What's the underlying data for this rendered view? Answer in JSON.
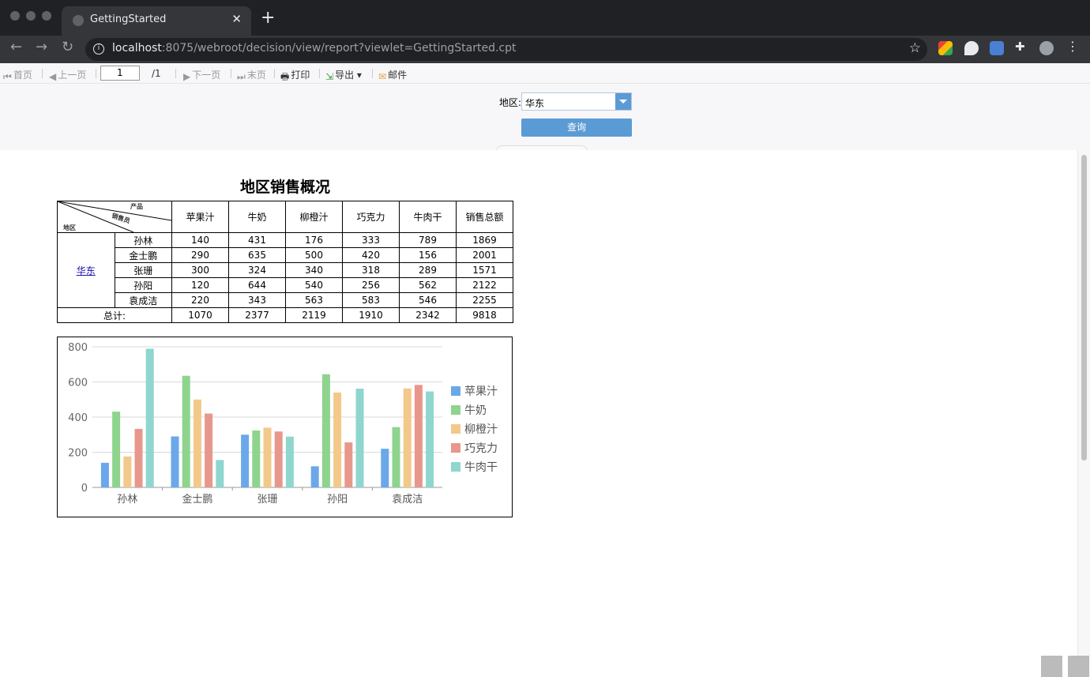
{
  "browser": {
    "tab_title": "GettingStarted",
    "url_host": "localhost",
    "url_rest": ":8075/webroot/decision/view/report?viewlet=GettingStarted.cpt"
  },
  "report_toolbar": {
    "first": "首页",
    "prev": "上一页",
    "page_value": "1",
    "page_total": "/1",
    "next": "下一页",
    "last": "末页",
    "print": "打印",
    "export": "导出",
    "mail": "邮件"
  },
  "params": {
    "region_label": "地区:",
    "region_value": "华东",
    "query_button": "查询"
  },
  "report": {
    "title": "地区销售概况",
    "header_diag": {
      "product": "产品",
      "salesperson": "销售员",
      "region": "地区"
    },
    "columns": [
      "苹果汁",
      "牛奶",
      "柳橙汁",
      "巧克力",
      "牛肉干",
      "销售总额"
    ],
    "region": "华东",
    "rows": [
      {
        "name": "孙林",
        "values": [
          "140",
          "431",
          "176",
          "333",
          "789",
          "1869"
        ]
      },
      {
        "name": "金士鹏",
        "values": [
          "290",
          "635",
          "500",
          "420",
          "156",
          "2001"
        ]
      },
      {
        "name": "张珊",
        "values": [
          "300",
          "324",
          "340",
          "318",
          "289",
          "1571"
        ]
      },
      {
        "name": "孙阳",
        "values": [
          "120",
          "644",
          "540",
          "256",
          "562",
          "2122"
        ]
      },
      {
        "name": "袁成洁",
        "values": [
          "220",
          "343",
          "563",
          "583",
          "546",
          "2255"
        ]
      }
    ],
    "total_label": "总计:",
    "totals": [
      "1070",
      "2377",
      "2119",
      "1910",
      "2342",
      "9818"
    ]
  },
  "chart_data": {
    "type": "bar",
    "categories": [
      "孙林",
      "金士鹏",
      "张珊",
      "孙阳",
      "袁成洁"
    ],
    "series": [
      {
        "name": "苹果汁",
        "color": "#6aa8ea",
        "values": [
          140,
          290,
          300,
          120,
          220
        ]
      },
      {
        "name": "牛奶",
        "color": "#8ed48e",
        "values": [
          431,
          635,
          324,
          644,
          343
        ]
      },
      {
        "name": "柳橙汁",
        "color": "#f2c98a",
        "values": [
          176,
          500,
          340,
          540,
          563
        ]
      },
      {
        "name": "巧克力",
        "color": "#e8978c",
        "values": [
          333,
          420,
          318,
          256,
          583
        ]
      },
      {
        "name": "牛肉干",
        "color": "#8fd6cf",
        "values": [
          789,
          156,
          289,
          562,
          546
        ]
      }
    ],
    "yticks": [
      "0",
      "200",
      "400",
      "600",
      "800"
    ],
    "ylim": [
      0,
      800
    ],
    "grid": true,
    "legend": "right"
  }
}
